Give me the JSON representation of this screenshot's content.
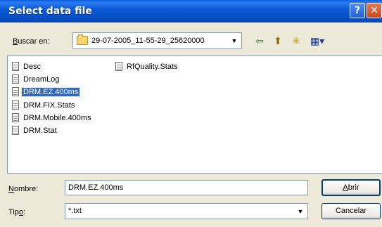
{
  "window": {
    "title": "Select data file",
    "help_glyph": "?",
    "close_glyph": "✕"
  },
  "lookin": {
    "label_prefix": "",
    "label_accel": "B",
    "label_rest": "uscar en:",
    "path": "29-07-2005_11-55-29_25620000",
    "dropdown_glyph": "▼"
  },
  "toolbar": {
    "back_glyph": "⇦",
    "up_glyph": "⬆",
    "newfolder_glyph": "✳",
    "views_glyph": "▦▾"
  },
  "files": [
    {
      "name": "Desc",
      "selected": false
    },
    {
      "name": "DreamLog",
      "selected": false
    },
    {
      "name": "DRM.EZ.400ms",
      "selected": true
    },
    {
      "name": "DRM.FIX.Stats",
      "selected": false
    },
    {
      "name": "DRM.Mobile.400ms",
      "selected": false
    },
    {
      "name": "DRM.Stat",
      "selected": false
    },
    {
      "name": "RfQuality.Stats",
      "selected": false
    }
  ],
  "filename": {
    "label_accel": "N",
    "label_rest": "ombre:",
    "value": "DRM.EZ.400ms"
  },
  "filetype": {
    "label_prefix": "Tip",
    "label_accel": "o",
    "label_rest": ":",
    "value": "*.txt",
    "dropdown_glyph": "▼"
  },
  "buttons": {
    "open_accel": "A",
    "open_rest": "brir",
    "cancel": "Cancelar"
  }
}
